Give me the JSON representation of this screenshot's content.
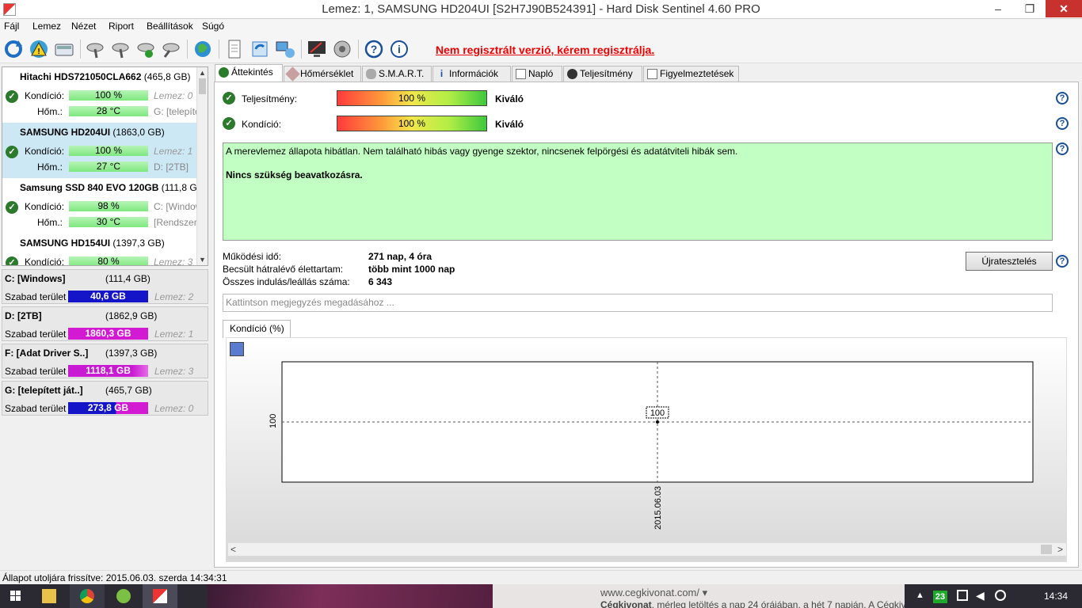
{
  "window": {
    "title": "Lemez: 1, SAMSUNG HD204UI [S2H7J90B524391]  -  Hard Disk Sentinel 4.60 PRO",
    "minimize": "–",
    "maximize": "❐",
    "close": "✕"
  },
  "menu": [
    "Fájl",
    "Lemez",
    "Nézet",
    "Riport",
    "Beállítások",
    "Súgó"
  ],
  "toolbar": {
    "warning": "Nem regisztrált verzió, kérem regisztrálja."
  },
  "disks": [
    {
      "name": "Hitachi HDS721050CLA662",
      "size": "(465,8 GB)",
      "cond_label": "Kondíció:",
      "cond": "100 %",
      "temp_label": "Hőm.:",
      "temp": "28 °C",
      "disk_no": "Lemez: 0",
      "letters": "G: [telepített"
    },
    {
      "name": "SAMSUNG HD204UI",
      "size": "(1863,0 GB)",
      "cond_label": "Kondíció:",
      "cond": "100 %",
      "temp_label": "Hőm.:",
      "temp": "27 °C",
      "disk_no": "Lemez: 1",
      "letters": "D: [2TB]"
    },
    {
      "name": "Samsung SSD 840 EVO 120GB",
      "size": "(111,8 GB)",
      "cond_label": "Kondíció:",
      "cond": "98 %",
      "temp_label": "Hőm.:",
      "temp": "30 °C",
      "disk_no": "C: [Window",
      "letters": "[Rendszer"
    },
    {
      "name": "SAMSUNG HD154UI",
      "size": "(1397,3 GB)",
      "cond_label": "Kondíció:",
      "cond": "80 %",
      "disk_no": "Lemez: 3"
    }
  ],
  "partitions": [
    {
      "name": "C: [Windows]",
      "size": "(111,4 GB)",
      "free_label": "Szabad terület",
      "free": "40,6 GB",
      "disk": "Lemez: 2",
      "color": "#1414c8"
    },
    {
      "name": "D: [2TB]",
      "size": "(1862,9 GB)",
      "free_label": "Szabad terület",
      "free": "1860,3 GB",
      "disk": "Lemez: 1",
      "color": "#d21ad2"
    },
    {
      "name": "F: [Adat Driver S..]",
      "size": "(1397,3 GB)",
      "free_label": "Szabad terület",
      "free": "1118,1 GB",
      "disk": "Lemez: 3",
      "color": "#c81ad2"
    },
    {
      "name": "G: [telepített ját..]",
      "size": "(465,7 GB)",
      "free_label": "Szabad terület",
      "free": "273,8 GB",
      "disk": "Lemez: 0",
      "color": "#1414c8"
    }
  ],
  "tabs": [
    "Áttekintés",
    "Hőmérséklet",
    "S.M.A.R.T.",
    "Információk",
    "Napló",
    "Teljesítmény",
    "Figyelmeztetések"
  ],
  "overview": {
    "perf_label": "Teljesítmény:",
    "perf_value": "100 %",
    "perf_rating": "Kiváló",
    "cond_label": "Kondíció:",
    "cond_value": "100 %",
    "cond_rating": "Kiváló",
    "status_text": "A merevlemez állapota hibátlan. Nem található hibás vagy gyenge szektor, nincsenek felpörgési és adatátviteli hibák sem.",
    "status_action": "Nincs szükség beavatkozásra.",
    "uptime_label": "Működési idő:",
    "uptime": "271 nap, 4 óra",
    "remaining_label": "Becsült hátralévő élettartam:",
    "remaining": "több mint 1000 nap",
    "starts_label": "Összes indulás/leállás száma:",
    "starts": "6 343",
    "retest": "Újratesztelés",
    "note_placeholder": "Kattintson megjegyzés megadásához ...",
    "chart_tab": "Kondíció  (%)"
  },
  "chart_data": {
    "type": "line",
    "x": [
      "2015.06.03"
    ],
    "series": [
      {
        "values": [
          100
        ]
      }
    ],
    "data_labels": [
      "100"
    ],
    "ylabel_tick": "100",
    "grid": true
  },
  "status_bar": "Állapot utoljára frissítve: 2015.06.03. szerda 14:34:31",
  "taskbar": {
    "url": "www.cegkivonat.com/ ▾",
    "desc_bold": "Cégkivonat",
    "desc": ", mérleg letöltés a nap 24 órájában, a hét 7 napján. A Cégkivonat.com-on",
    "badge": "23",
    "clock": "14:34"
  }
}
